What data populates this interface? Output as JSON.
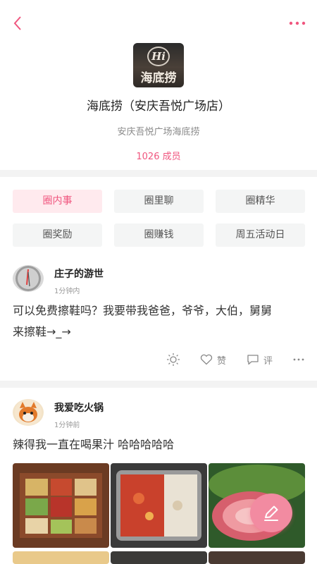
{
  "header": {
    "back_icon": "chevron-left-icon",
    "more_icon": "more-dots-icon",
    "accent_color": "#f0567f"
  },
  "store": {
    "logo_mark": "Hi",
    "logo_text": "海底捞",
    "title": "海底捞（安庆吾悦广场店）",
    "subtitle": "安庆吾悦广场海底捞",
    "members": "1026 成员"
  },
  "tags": [
    {
      "label": "圈内事",
      "active": true
    },
    {
      "label": "圈里聊",
      "active": false
    },
    {
      "label": "圈精华",
      "active": false
    },
    {
      "label": "圈奖励",
      "active": false
    },
    {
      "label": "圈赚钱",
      "active": false
    },
    {
      "label": "周五活动日",
      "active": false
    }
  ],
  "posts": [
    {
      "user": "庄子的游世",
      "time": "1分钟内",
      "text_line1": "可以免费擦鞋吗？我要带我爸爸，爷爷，大伯，舅舅",
      "text_line2": "来擦鞋→_→",
      "actions": {
        "like_label": "赞",
        "comment_label": "评"
      }
    },
    {
      "user": "我爱吃火锅",
      "time": "1分钟前",
      "text": "辣得我一直在喝果汁  哈哈哈哈哈"
    }
  ],
  "fab": {
    "icon": "pencil-icon"
  }
}
